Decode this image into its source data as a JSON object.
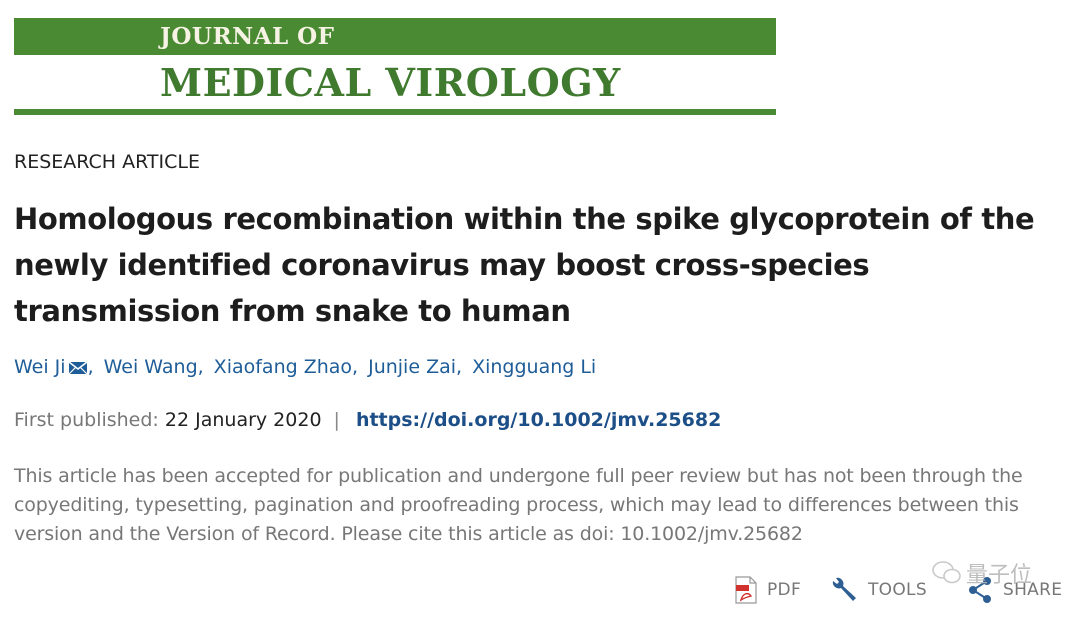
{
  "journal": {
    "line1": "JOURNAL OF",
    "line2": "MEDICAL VIROLOGY"
  },
  "article_type": "RESEARCH ARTICLE",
  "title": "Homologous recombination within the spike glycoprotein of the newly identified coronavirus may boost cross‐species transmission from snake to human",
  "authors": [
    {
      "name": "Wei Ji"
    },
    {
      "name": "Wei Wang"
    },
    {
      "name": "Xiaofang Zhao"
    },
    {
      "name": "Junjie Zai"
    },
    {
      "name": "Xingguang Li"
    }
  ],
  "publication": {
    "label": "First published:",
    "date": "22 January 2020",
    "separator": "|",
    "doi_link": "https://doi.org/10.1002/jmv.25682"
  },
  "notice": "This article has been accepted for publication and undergone full peer review but has not been through the copyediting, typesetting, pagination and proofreading process, which may lead to differences between this version and the Version of Record. Please cite this article as doi: 10.1002/jmv.25682",
  "toolbar": {
    "pdf_label": "PDF",
    "tools_label": "TOOLS",
    "share_label": "SHARE"
  },
  "watermark": {
    "text": "量子位"
  },
  "colors": {
    "brand_green": "#4a8a32",
    "link_blue": "#1f5d99",
    "doi_blue": "#1c4e87"
  }
}
